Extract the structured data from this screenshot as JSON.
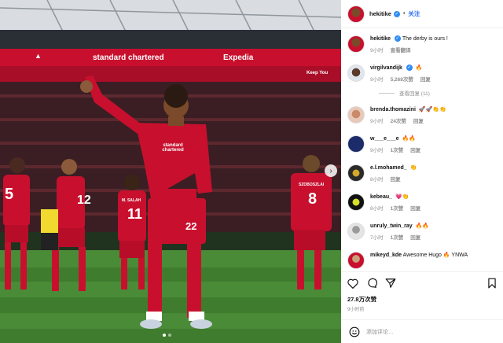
{
  "photo": {
    "banner_left": "standard chartered",
    "banner_right": "Expedia",
    "banner_far_right": "Keep You",
    "player_main_number": "22",
    "player_left_number": "5",
    "player_left2_number": "12",
    "player_center_number": "11",
    "player_center_name": "M. SALAH",
    "player_right_number": "8",
    "player_right_name": "SZOBOSZLAI",
    "shirt_sponsor": "standard chartered"
  },
  "post": {
    "author": "hekitike",
    "follow_label": "关注",
    "dot": "•"
  },
  "comments": [
    {
      "user": "hekitike",
      "text": "The derby is ours !",
      "time": "9小时",
      "likes": "",
      "action": "查看翻译",
      "emoji": "",
      "verified": true
    },
    {
      "user": "virgilvandijk",
      "text": "",
      "time": "9小时",
      "likes": "5,268次赞",
      "action": "回复",
      "emoji": "🔥",
      "verified": true,
      "replies": "查看回复 (11)"
    },
    {
      "user": "brenda.thomazini",
      "text": "",
      "time": "9小时",
      "likes": "24次赞",
      "action": "回复",
      "emoji": "🚀🚀👏👏",
      "verified": false
    },
    {
      "user": "w___e___e",
      "text": "",
      "time": "9小时",
      "likes": "1次赞",
      "action": "回复",
      "emoji": "🔥🔥",
      "verified": false
    },
    {
      "user": "e.l.mohamed_",
      "text": "",
      "time": "8小时",
      "likes": "",
      "action": "回复",
      "emoji": "👏",
      "verified": false
    },
    {
      "user": "kebeau_",
      "text": "",
      "time": "8小时",
      "likes": "1次赞",
      "action": "回复",
      "emoji": "💗👏",
      "verified": false
    },
    {
      "user": "unruly_twin_ray",
      "text": "",
      "time": "7小时",
      "likes": "1次赞",
      "action": "回复",
      "emoji": "🔥🔥",
      "verified": false
    },
    {
      "user": "mikeyd_kde",
      "text": "Awesome Hugo 🔥 YNWA",
      "time": "",
      "likes": "",
      "action": "",
      "emoji": "",
      "verified": false
    }
  ],
  "actions": {
    "likes": "27.8万次赞",
    "time": "9小时前",
    "add_comment_placeholder": "添加评论…"
  },
  "icons": [
    "heart-icon",
    "comment-icon",
    "share-icon",
    "bookmark-icon",
    "emoji-icon",
    "chevron-right-icon"
  ],
  "colors": {
    "accent": "#2f6ff5",
    "verified": "#2f8cf5",
    "kit_red": "#c8102e"
  }
}
